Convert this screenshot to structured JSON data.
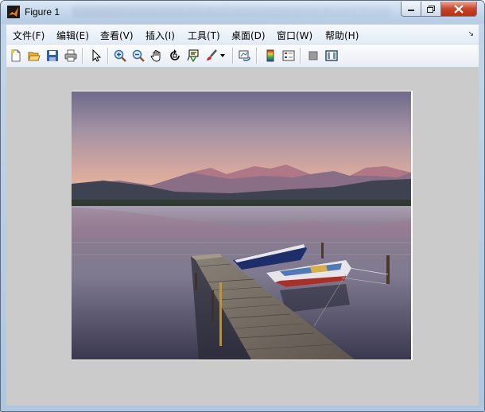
{
  "window": {
    "title": "Figure 1"
  },
  "menu": [
    {
      "label": "文件(F)"
    },
    {
      "label": "编辑(E)"
    },
    {
      "label": "查看(V)"
    },
    {
      "label": "插入(I)"
    },
    {
      "label": "工具(T)"
    },
    {
      "label": "桌面(D)"
    },
    {
      "label": "窗口(W)"
    },
    {
      "label": "帮助(H)"
    }
  ],
  "toolbar": [
    "new-figure-icon",
    "open-file-icon",
    "save-icon",
    "print-icon",
    "select-arrow-icon",
    "zoom-in-icon",
    "zoom-out-icon",
    "pan-hand-icon",
    "rotate-3d-icon",
    "data-cursor-icon",
    "brush-icon",
    "brush-dropdown-icon",
    "link-plot-icon",
    "colorbar-icon",
    "legend-icon",
    "hide-plot-tools-icon",
    "show-plot-tools-icon"
  ],
  "colors": {
    "title_bar": "#c6d8ec",
    "close_button": "#c9442a",
    "figure_background": "#cbcbcb"
  }
}
